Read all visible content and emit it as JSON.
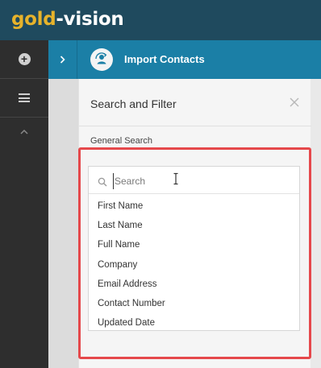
{
  "app": {
    "logo_part1": "gold",
    "logo_part2": "-vision",
    "colors": {
      "topbar": "#1f4a5e",
      "header": "#1b7fa6",
      "accent": "#e7b32b",
      "highlight": "#e5484b"
    }
  },
  "sidebar": {
    "icons": [
      "plus-circle-icon",
      "hamburger-menu-icon",
      "chevron-up-icon"
    ]
  },
  "header": {
    "title": "Import Contacts",
    "icon": "import-contacts-icon"
  },
  "panel": {
    "title": "Search and Filter",
    "section_label": "General Search",
    "search": {
      "placeholder": "Search",
      "value": ""
    },
    "options": [
      "First Name",
      "Last Name",
      "Full Name",
      "Company",
      "Email Address",
      "Contact Number",
      "Updated Date"
    ]
  }
}
